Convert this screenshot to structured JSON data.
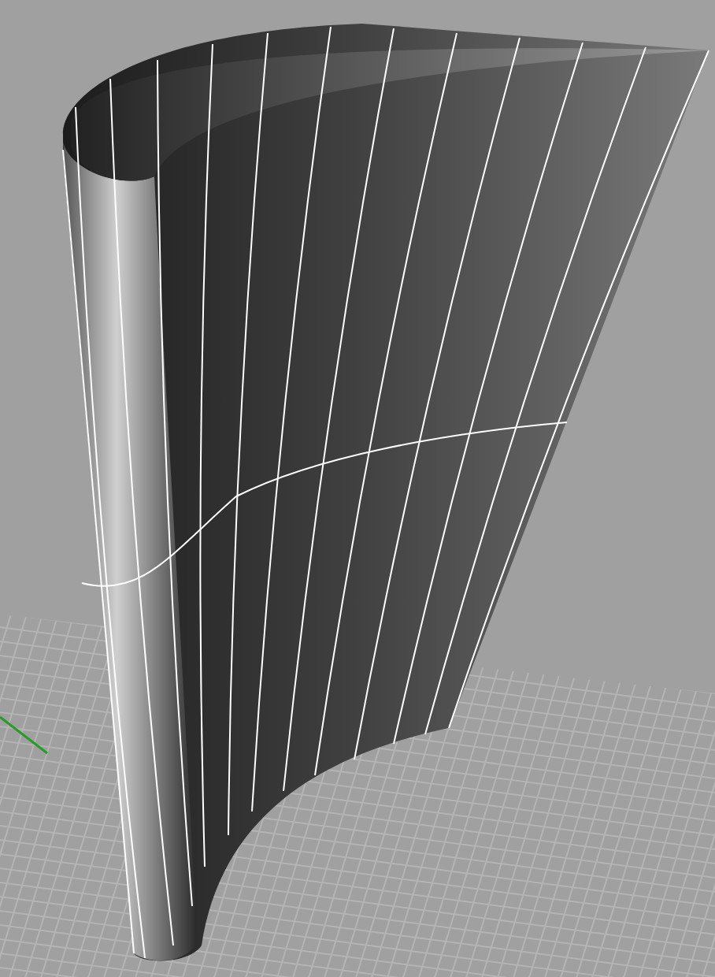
{
  "viewport": {
    "grid": true,
    "isocurves": true
  }
}
